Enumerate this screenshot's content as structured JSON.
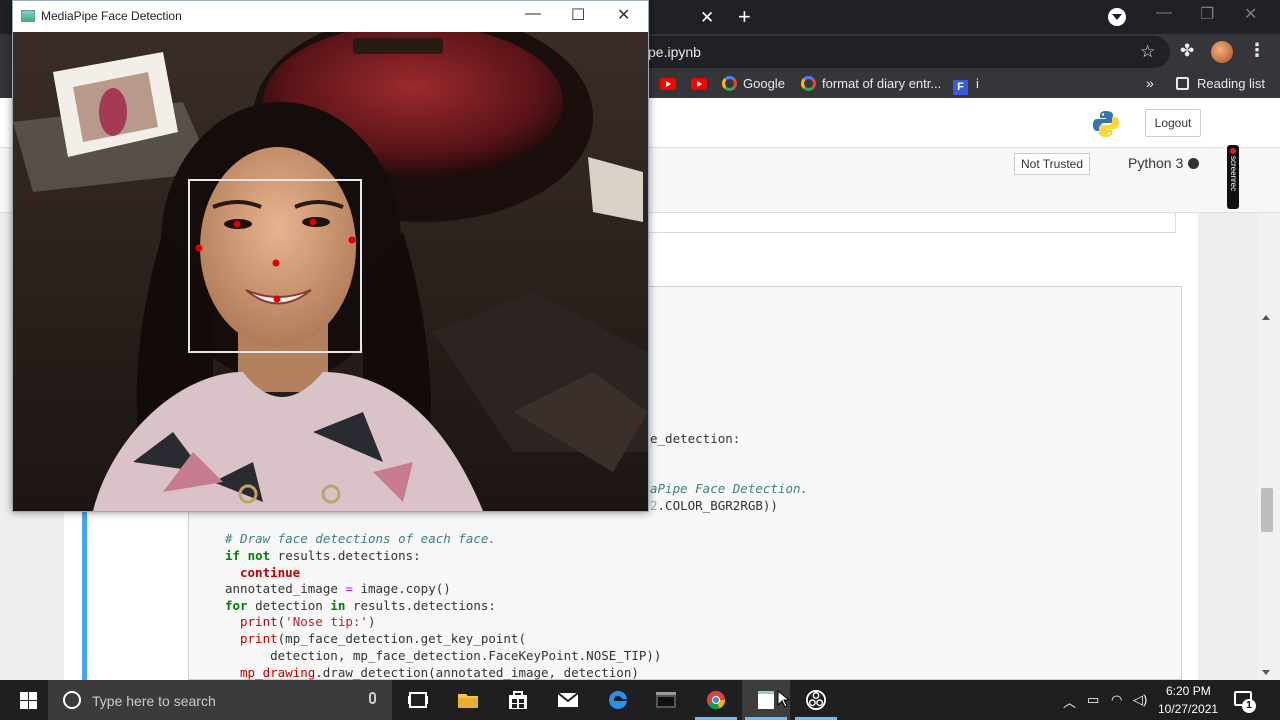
{
  "browser": {
    "tab_close_glyph": "✕",
    "new_tab_glyph": "+",
    "url_visible": "pe.ipynb",
    "bookmarks": [
      {
        "label": "Google"
      },
      {
        "label": "format of diary entr..."
      },
      {
        "label": "i"
      }
    ],
    "reading_list": "Reading list",
    "more_glyph": "»"
  },
  "jupyter": {
    "logout_label": "Logout",
    "trusted_label": "Not Trusted",
    "kernel_name": "Python 3",
    "screenrec_label": "screenrec",
    "code_fragments": {
      "frag1": "e_detection:",
      "frag2": "aPipe Face Detection.",
      "frag3": ".COLOR_BGR2RGB))"
    },
    "code": {
      "l1_comment": "# Draw face detections of each face.",
      "l2_if": "if not",
      "l2_rest": " results.detections:",
      "l3_continue": "continue",
      "l4_lhs": "annotated_image ",
      "l4_eq": "=",
      "l4_rhs": " image.copy()",
      "l5_for": "for",
      "l5_mid": " detection ",
      "l5_in": "in",
      "l5_rest": " results.detections:",
      "l6_print": "print",
      "l6_str": "'Nose tip:'",
      "l7_print": "print",
      "l7_rest": "(mp_face_detection.get_key_point(",
      "l8": "    detection, mp_face_detection.FaceKeyPoint.NOSE_TIP))",
      "l9_fn": "mp_drawing",
      "l9_rest": ".draw_detection(annotated_image, detection)"
    }
  },
  "mediapipe_window": {
    "title": "MediaPipe Face Detection",
    "minimize_glyph": "—",
    "maximize_glyph": "☐",
    "close_glyph": "✕"
  },
  "taskbar": {
    "search_placeholder": "Type here to search",
    "time": "6:20 PM",
    "date": "10/27/2021",
    "notification_count": "1"
  },
  "colors": {
    "keypoint": "#e00000",
    "detection_box": "#e6e6e6",
    "cell_selected": "#42a5f5"
  }
}
